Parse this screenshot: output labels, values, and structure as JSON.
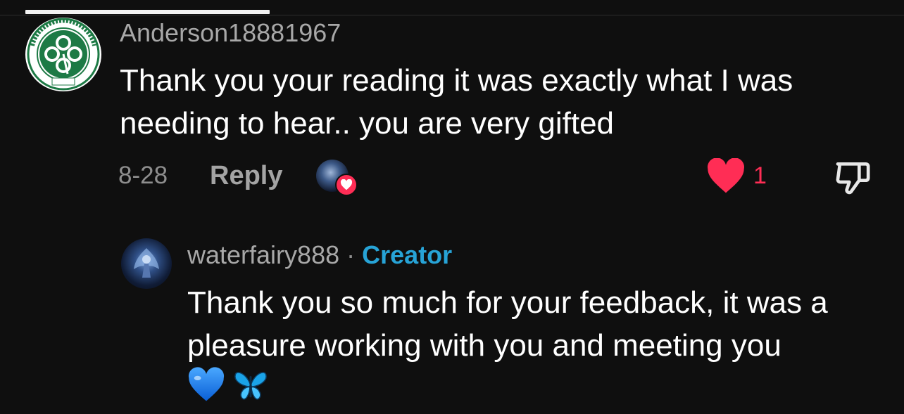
{
  "top_comment": {
    "username": "Anderson18881967",
    "avatar_name": "celtic-football-club-crest",
    "avatar_lettering": "THE CELTIC FOOTBALL CLUB 1888",
    "text_line1": "Thank you your reading it was exactly what I was",
    "text_line2": "needing to hear.. you are very gifted",
    "date": "8-28",
    "reply_label": "Reply",
    "like_count": "1",
    "liked_by_creator": true
  },
  "reply_comment": {
    "username": "waterfairy888",
    "separator": "·",
    "creator_label": "Creator",
    "text_line1": "Thank you so much for your feedback, it was a",
    "text_line2": "pleasure working with you and meeting you",
    "emojis": [
      "blue-heart-icon",
      "butterfly-icon"
    ]
  },
  "colors": {
    "background": "#0f0f0f",
    "like_red": "#ff2d55",
    "creator_blue": "#27a3d6",
    "secondary_text": "#a8a8a8"
  }
}
